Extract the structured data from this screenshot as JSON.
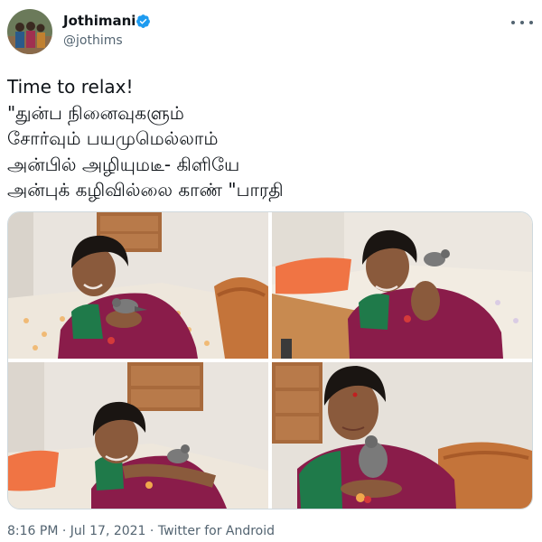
{
  "author": {
    "name": "Jothimani",
    "handle": "@jothims",
    "verified": true
  },
  "tweet": {
    "text": "Time to relax!\n\"துன்ப நினைவுகளும்\nசோர்வும் பயமுமெல்லாம்\nஅன்பில் அழியுமடீ-  கிளியே\nஅன்புக் கழிவில்லை காண் \"பாரதி"
  },
  "media": {
    "photo_count": 4
  },
  "meta": {
    "time": "8:16 PM",
    "separator": " · ",
    "date": "Jul 17, 2021",
    "source": "Twitter for Android"
  },
  "colors": {
    "primary_text": "#0f1419",
    "secondary_text": "#536471",
    "verified_blue": "#1d9bf0",
    "saree_magenta": "#8a1c4a",
    "blouse_green": "#1f7a4a",
    "pillow_orange": "#f07444"
  },
  "icons": [
    "verified-badge-icon",
    "more-options-icon"
  ]
}
